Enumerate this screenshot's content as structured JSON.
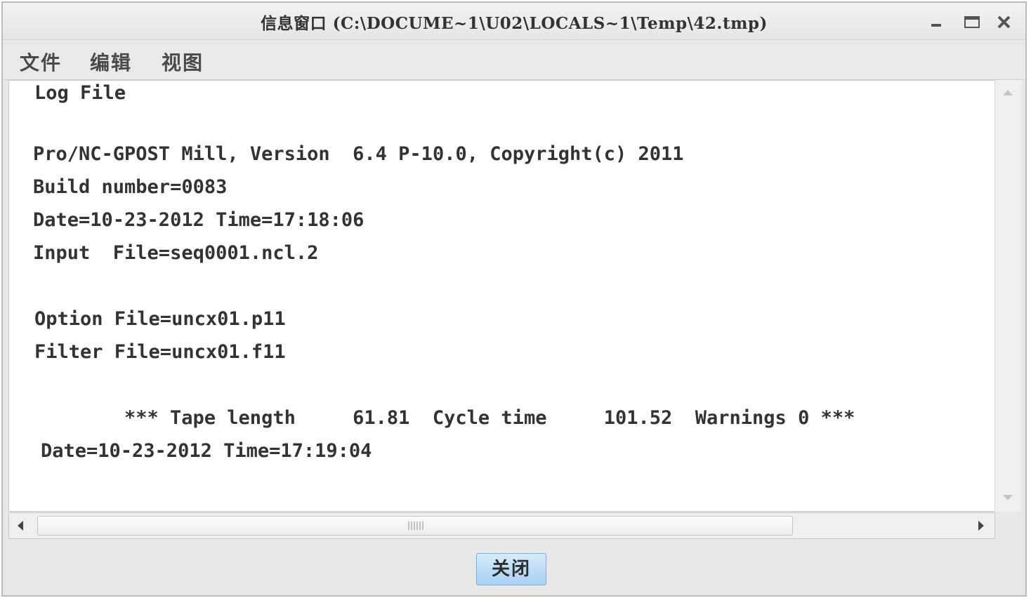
{
  "window": {
    "title": "信息窗口 (C:\\DOCUME~1\\U02\\LOCALS~1\\Temp\\42.tmp)"
  },
  "menu": {
    "items": [
      {
        "label": "文件"
      },
      {
        "label": "编辑"
      },
      {
        "label": "视图"
      }
    ]
  },
  "log": {
    "lines": [
      "Log File",
      "Pro/NC-GPOST Mill, Version  6.4 P-10.0, Copyright(c) 2011",
      "Build number=0083",
      "Date=10-23-2012 Time=17:18:06",
      "Input  File=seq0001.ncl.2",
      "Option File=uncx01.p11",
      "Filter File=uncx01.f11",
      "*** Tape length     61.81  Cycle time     101.52  Warnings 0 ***",
      "Date=10-23-2012 Time=17:19:04"
    ]
  },
  "buttons": {
    "close_label": "关闭"
  },
  "icons": {
    "minimize": "minimize-icon",
    "maximize": "maximize-icon",
    "close": "close-icon",
    "scroll_up": "arrow-up-icon",
    "scroll_down": "arrow-down-icon",
    "scroll_left": "arrow-left-icon",
    "scroll_right": "arrow-right-icon"
  },
  "colors": {
    "accent_button": "#a6d0f3",
    "text": "#333333"
  }
}
